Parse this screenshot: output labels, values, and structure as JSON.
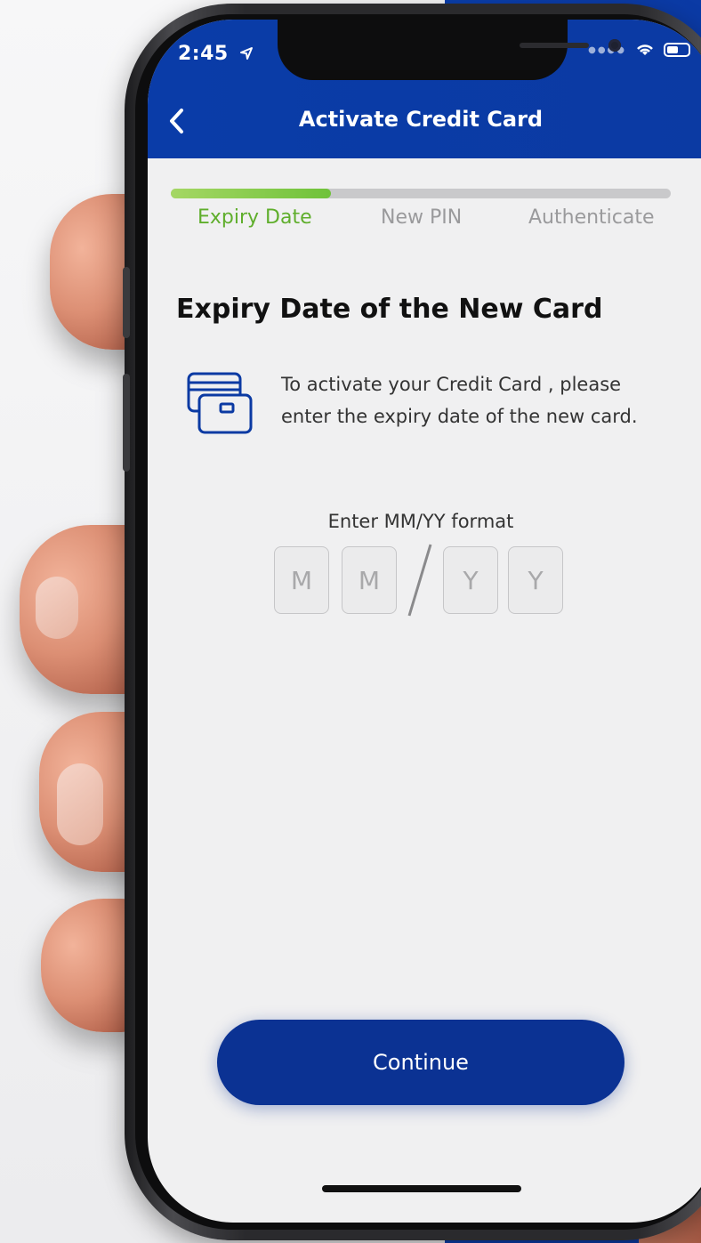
{
  "status_bar": {
    "time": "2:45",
    "location_icon": "location-arrow-icon",
    "signal_icon": "signal-dots-icon",
    "wifi_icon": "wifi-icon",
    "battery_icon": "battery-icon"
  },
  "header": {
    "back_icon": "chevron-left-icon",
    "back_glyph": "‹",
    "title": "Activate Credit Card"
  },
  "stepper": {
    "progress": 0.32,
    "steps": [
      {
        "label": "Expiry Date",
        "active": true
      },
      {
        "label": "New PIN",
        "active": false
      },
      {
        "label": "Authenticate",
        "active": false
      }
    ]
  },
  "content": {
    "heading": "Expiry Date of the New Card",
    "card_icon": "credit-cards-icon",
    "description": "To activate your Credit Card , please enter the expiry date of the new card.",
    "format_label": "Enter MM/YY format",
    "month_placeholders": [
      "M",
      "M"
    ],
    "year_placeholders": [
      "Y",
      "Y"
    ]
  },
  "footer": {
    "continue_label": "Continue"
  },
  "colors": {
    "brand_blue": "#0b3aa3",
    "button_blue": "#0b3293",
    "active_step_green": "#5fae2c",
    "progress_green": "#6fc23a"
  }
}
